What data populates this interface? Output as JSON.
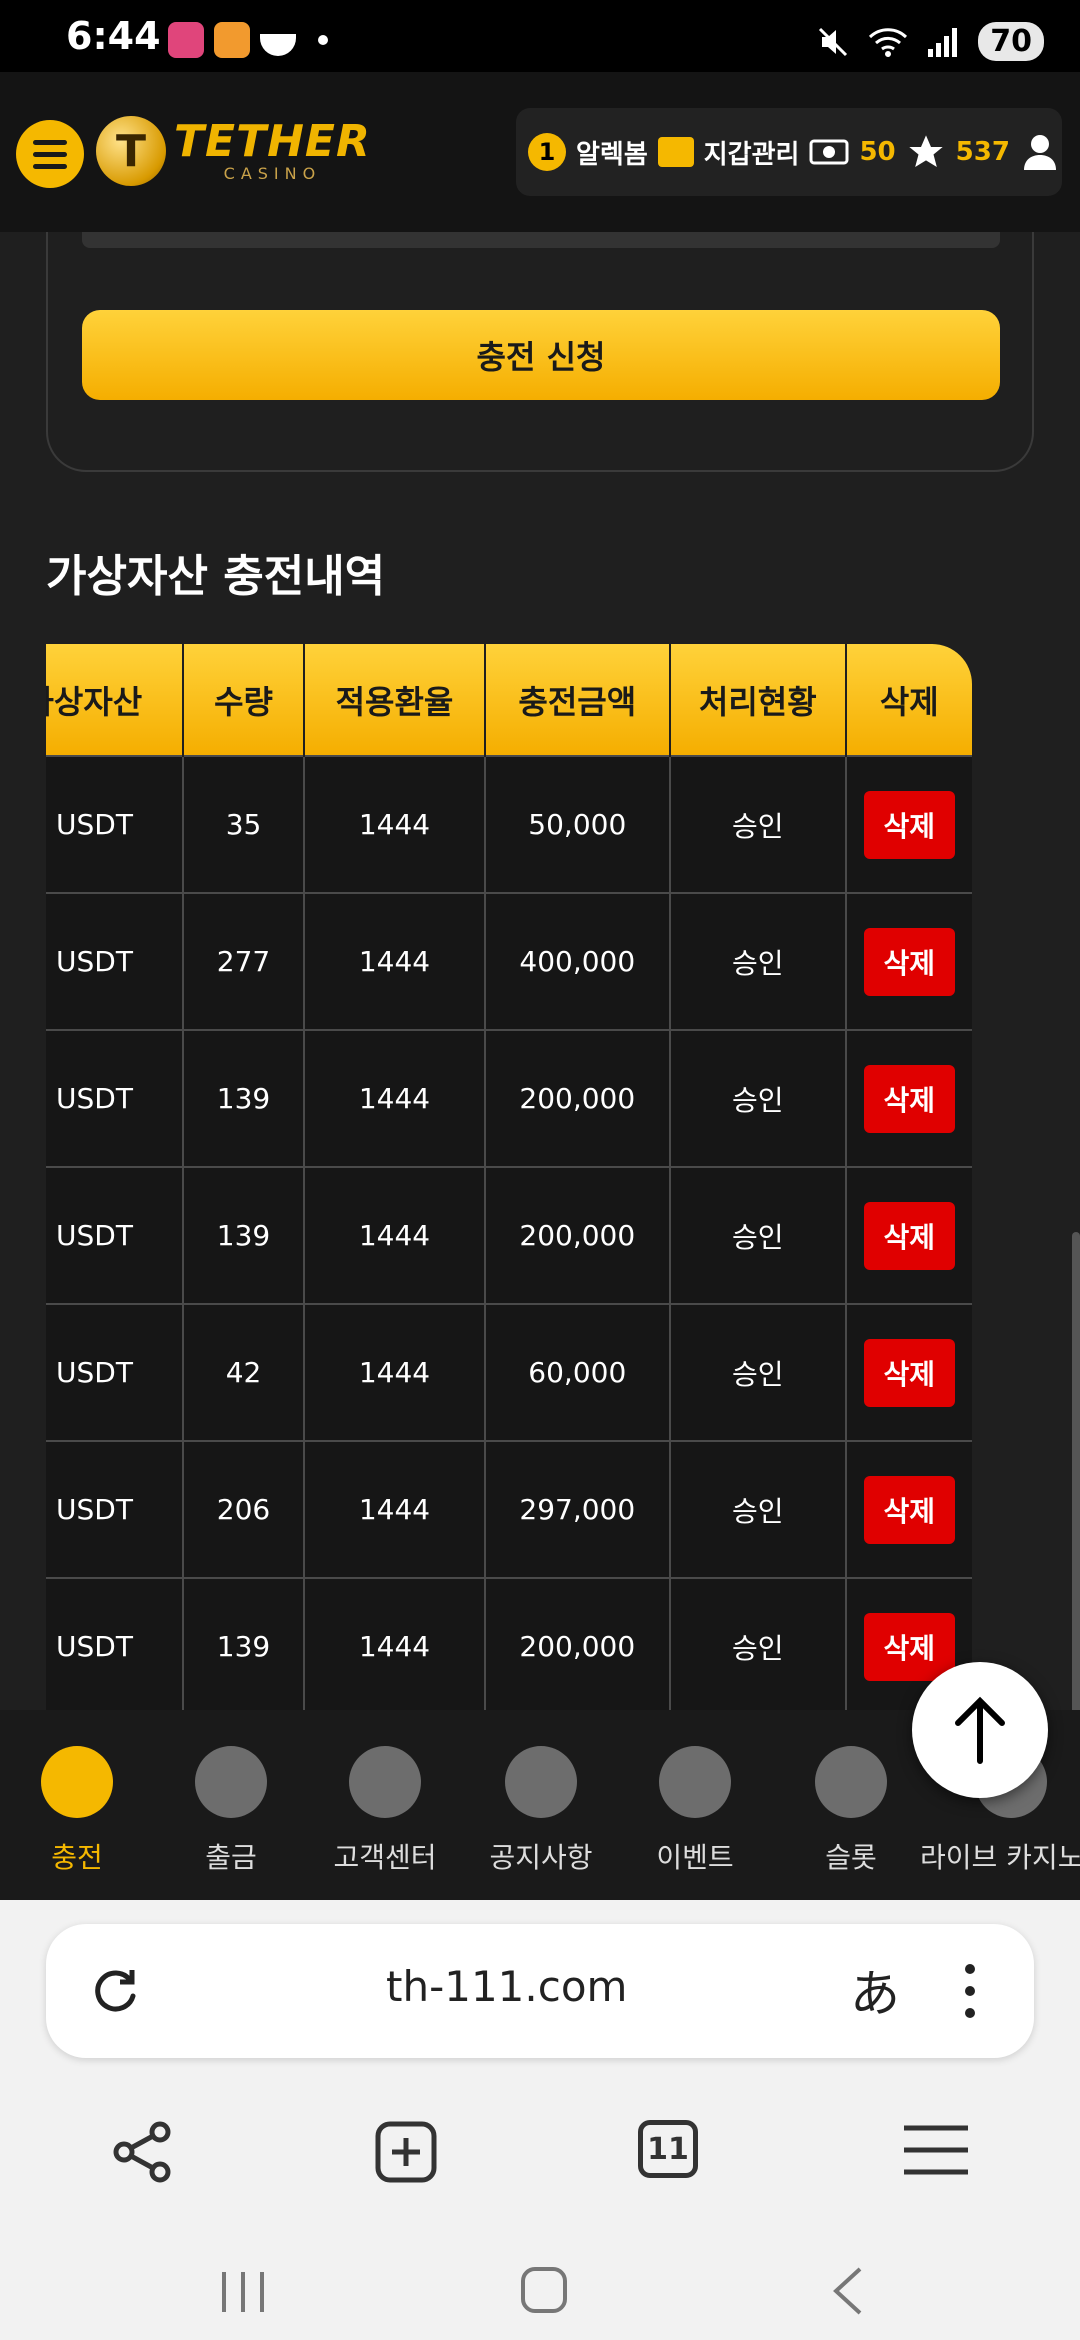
{
  "status_bar": {
    "time": "6:44",
    "battery": "70"
  },
  "header": {
    "logo_main": "TETHER",
    "logo_sub": "CASINO",
    "coin_symbol": "T",
    "alert_count": "1",
    "alert_label": "알렉봄",
    "wallet_label": "지갑관리",
    "cash_value": "50",
    "points_value": "537"
  },
  "form": {
    "submit_label": "충전 신청"
  },
  "history": {
    "title": "가상자산 충전내역",
    "columns": [
      "가상자산",
      "수량",
      "적용환율",
      "충전금액",
      "처리현황",
      "삭제"
    ],
    "rows": [
      {
        "asset": "USDT",
        "qty": "35",
        "rate": "1444",
        "amount": "50,000",
        "status": "승인",
        "delete": "삭제"
      },
      {
        "asset": "USDT",
        "qty": "277",
        "rate": "1444",
        "amount": "400,000",
        "status": "승인",
        "delete": "삭제"
      },
      {
        "asset": "USDT",
        "qty": "139",
        "rate": "1444",
        "amount": "200,000",
        "status": "승인",
        "delete": "삭제"
      },
      {
        "asset": "USDT",
        "qty": "139",
        "rate": "1444",
        "amount": "200,000",
        "status": "승인",
        "delete": "삭제"
      },
      {
        "asset": "USDT",
        "qty": "42",
        "rate": "1444",
        "amount": "60,000",
        "status": "승인",
        "delete": "삭제"
      },
      {
        "asset": "USDT",
        "qty": "206",
        "rate": "1444",
        "amount": "297,000",
        "status": "승인",
        "delete": "삭제"
      },
      {
        "asset": "USDT",
        "qty": "139",
        "rate": "1444",
        "amount": "200,000",
        "status": "승인",
        "delete": "삭제"
      }
    ]
  },
  "bottom_nav": {
    "items": [
      {
        "label": "충전",
        "icon": "deposit-icon",
        "active": true
      },
      {
        "label": "출금",
        "icon": "withdraw-icon",
        "active": false
      },
      {
        "label": "고객센터",
        "icon": "support-icon",
        "active": false
      },
      {
        "label": "공지사항",
        "icon": "bell-icon",
        "active": false
      },
      {
        "label": "이벤트",
        "icon": "gift-icon",
        "active": false
      },
      {
        "label": "슬롯",
        "icon": "slot-machine-icon",
        "active": false
      },
      {
        "label": "라이브 카지노",
        "icon": "live-casino-icon",
        "active": false
      }
    ]
  },
  "browser": {
    "url": "th-111.com",
    "tab_count": "11",
    "lang_glyph": "あ"
  },
  "colors": {
    "accent": "#f5b800",
    "delete": "#e00000",
    "background": "#1f1f1f"
  }
}
